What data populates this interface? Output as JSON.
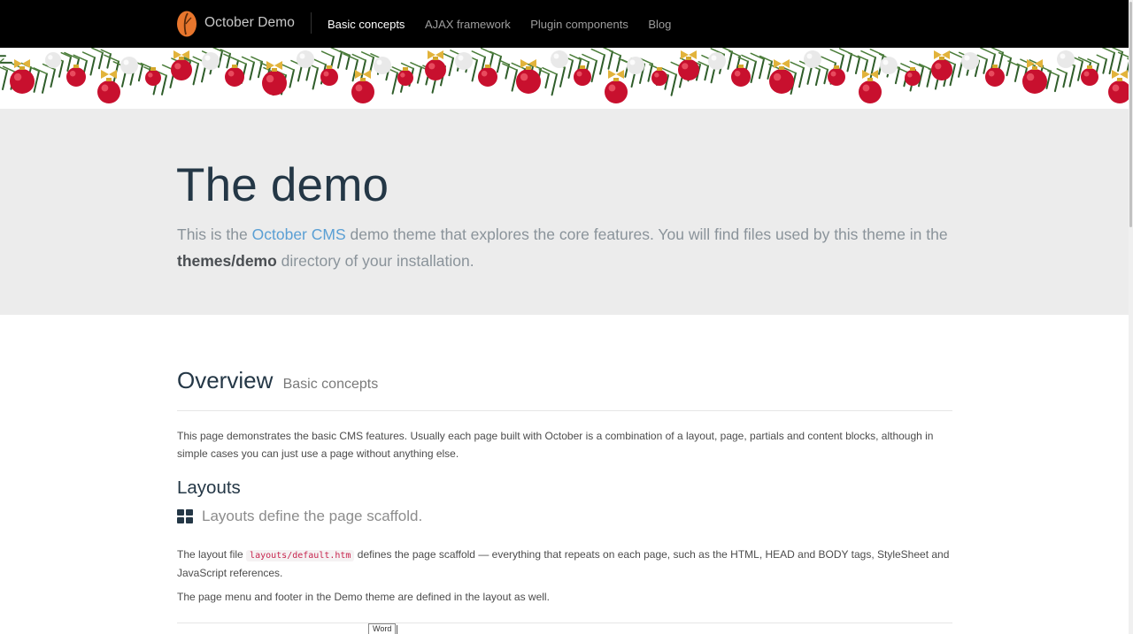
{
  "navbar": {
    "brand_name": "October Demo",
    "links": [
      {
        "label": "Basic concepts",
        "active": true
      },
      {
        "label": "AJAX framework",
        "active": false
      },
      {
        "label": "Plugin components",
        "active": false
      },
      {
        "label": "Blog",
        "active": false
      }
    ]
  },
  "banner": {
    "decoration": "christmas-garland"
  },
  "jumbotron": {
    "title": "The demo",
    "lead_before": "This is the ",
    "lead_link": "October CMS",
    "lead_middle": " demo theme that explores the core features. You will find files used by this theme in the ",
    "lead_bold": "themes/demo",
    "lead_after": " directory of your installation."
  },
  "overview": {
    "title": "Overview",
    "subtitle": "Basic concepts",
    "intro": "This page demonstrates the basic CMS features. Usually each page built with October is a combination of a layout, page, partials and content blocks, although in simple cases you can just use a page without anything else."
  },
  "layouts": {
    "heading": "Layouts",
    "tagline": "Layouts define the page scaffold.",
    "tagline_icon": "grid-icon",
    "p1_before": "The layout file ",
    "p1_code": "layouts/default.htm",
    "p1_after": " defines the page scaffold — everything that repeats on each page, such as the HTML, HEAD and BODY tags, StyleSheet and JavaScript references.",
    "p2": "The page menu and footer in the Demo theme are defined in the layout as well."
  },
  "tooltip": {
    "text": "Word"
  },
  "colors": {
    "navbar_bg": "#000000",
    "jumbo_bg": "#ececec",
    "heading": "#243746",
    "link": "#5a9fd4",
    "logo": "#e8762d"
  }
}
